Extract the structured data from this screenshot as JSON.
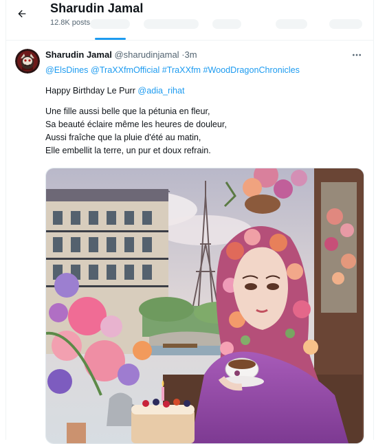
{
  "header": {
    "title": "Sharudin Jamal",
    "posts_count": "12.8K posts"
  },
  "tweet": {
    "author_name": "Sharudin Jamal",
    "author_handle": "@sharudinjamal",
    "separator": "·",
    "time": "3m",
    "mention_elsdines": "@ElsDines",
    "mention_traxxfmofficial": "@TraXXfmOfficial",
    "hashtag_traxxfm": "#TraXXfm",
    "hashtag_wooddragon": "#WoodDragonChronicles",
    "birthday_prefix": "Happy Birthday Le Purr",
    "mention_adia": "@adia_rihat",
    "poem": [
      "Une fille aussi belle que la pétunia en fleur,",
      "Sa beauté éclaire même les heures de douleur,",
      "Aussi fraîche que la pluie d'été au matin,",
      "Elle embellit la terre, un pur et doux refrain."
    ]
  },
  "colors": {
    "accent": "#1d9bf0",
    "text_primary": "#0f1419",
    "text_secondary": "#536471",
    "divider": "#eff3f4"
  },
  "icons": {
    "back": "back-arrow-icon",
    "more": "more-horizontal-icon"
  }
}
